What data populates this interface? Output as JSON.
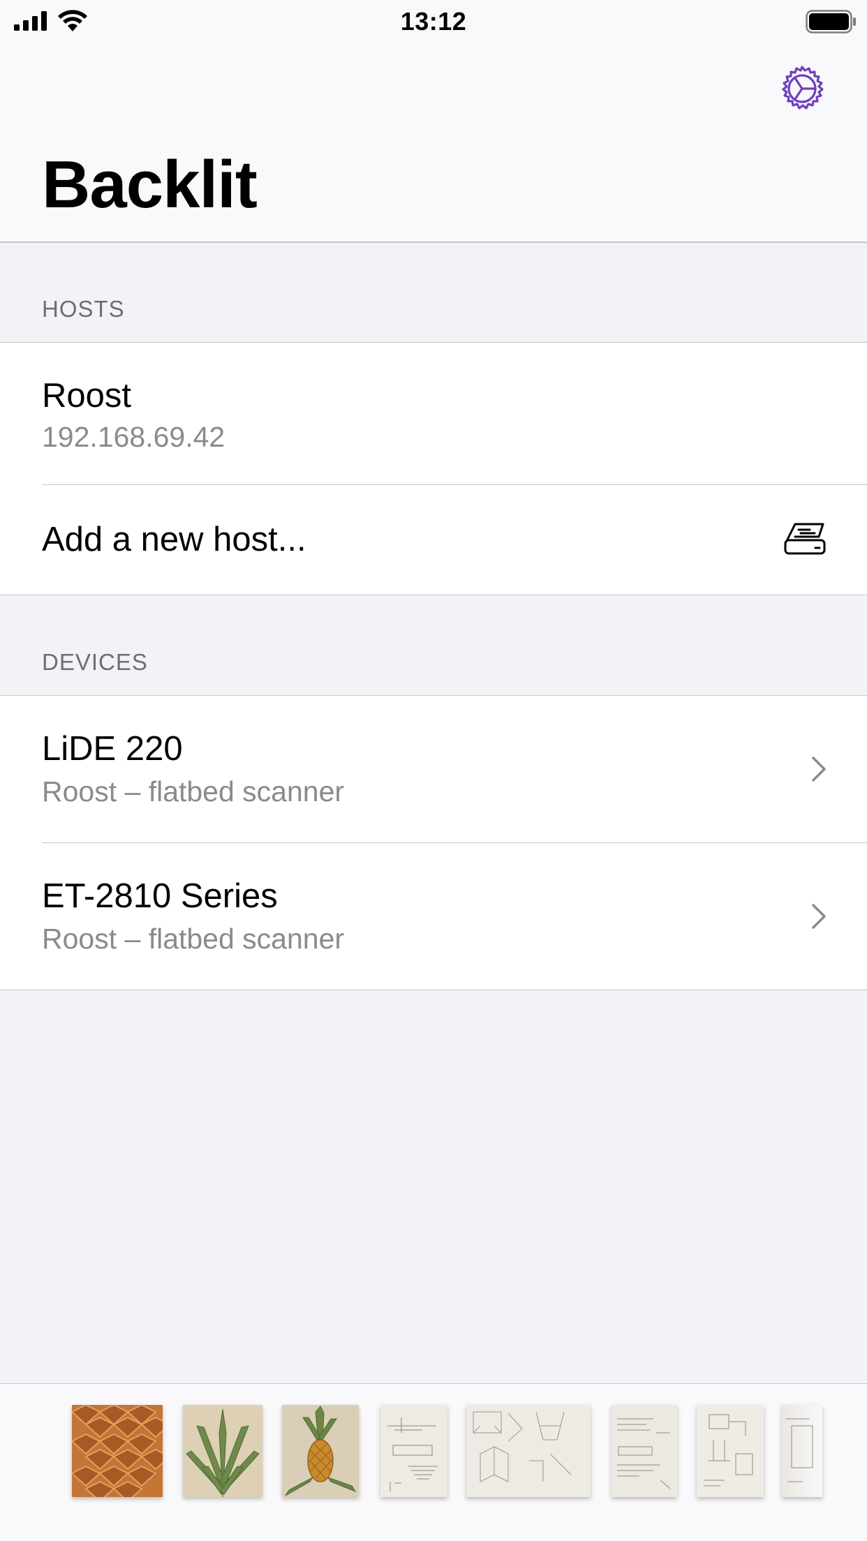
{
  "status_bar": {
    "time": "13:12"
  },
  "nav": {
    "title": "Backlit",
    "settings_icon": "gear-icon",
    "accent_color": "#6e3fbf"
  },
  "hosts_section": {
    "header": "HOSTS",
    "items": [
      {
        "title": "Roost",
        "subtitle": "192.168.69.42"
      },
      {
        "title": "Add a new host...",
        "icon": "scanner-icon"
      }
    ]
  },
  "devices_section": {
    "header": "DEVICES",
    "items": [
      {
        "title": "LiDE 220",
        "subtitle": "Roost – flatbed scanner"
      },
      {
        "title": "ET-2810 Series",
        "subtitle": "Roost – flatbed scanner"
      }
    ]
  },
  "thumbnails": [
    {
      "name": "pineapple-skin-scan",
      "color": "#c77a3a"
    },
    {
      "name": "pineapple-leaves-scan",
      "color": "#d9c9a8"
    },
    {
      "name": "pineapple-fruit-scan",
      "color": "#d7cbb0"
    },
    {
      "name": "sketch-scan-1",
      "color": "#ece8df"
    },
    {
      "name": "sketch-scan-2",
      "color": "#ece9e2"
    },
    {
      "name": "sketch-scan-3",
      "color": "#ebe8e0"
    },
    {
      "name": "sketch-scan-4",
      "color": "#eeebe4"
    },
    {
      "name": "sketch-scan-5",
      "color": "#ece9e2"
    }
  ]
}
